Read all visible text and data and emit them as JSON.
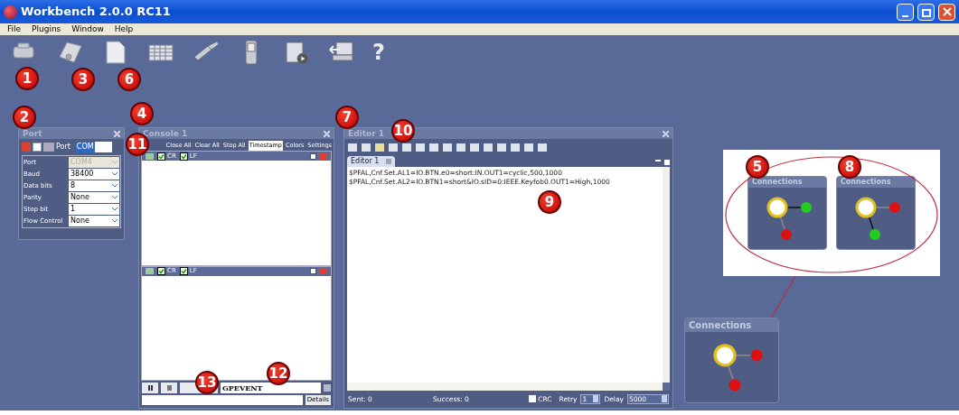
{
  "window": {
    "title": "Workbench 2.0.0 RC11"
  },
  "menu": [
    "File",
    "Plugins",
    "Window",
    "Help"
  ],
  "toolbar": {
    "help_glyph": "?"
  },
  "port": {
    "title": "Port",
    "port_label": "Port",
    "port_select": "COM",
    "fields": [
      {
        "label": "Port",
        "value": "COM4",
        "disabled": true
      },
      {
        "label": "Baud",
        "value": "38400",
        "disabled": false
      },
      {
        "label": "Data bits",
        "value": "8",
        "disabled": false
      },
      {
        "label": "Parity",
        "value": "None",
        "disabled": false
      },
      {
        "label": "Stop bit",
        "value": "1",
        "disabled": false
      },
      {
        "label": "Flow Control",
        "value": "None",
        "disabled": false
      }
    ]
  },
  "console": {
    "title": "Console 1",
    "tabs": [
      {
        "label": "Close All",
        "selected": false
      },
      {
        "label": "Clear All",
        "selected": false
      },
      {
        "label": "Stop All",
        "selected": false
      },
      {
        "label": "Timestamp",
        "selected": true
      },
      {
        "label": "Colors",
        "selected": false
      },
      {
        "label": "Settings",
        "selected": false
      }
    ],
    "panes": [
      {
        "options": [
          {
            "label": "CR",
            "checked": true
          },
          {
            "label": "LF",
            "checked": true
          }
        ]
      },
      {
        "options": [
          {
            "label": "CR",
            "checked": true
          },
          {
            "label": "LF",
            "checked": true
          }
        ]
      }
    ],
    "command": "GPEVENT",
    "details_button": "Details"
  },
  "editor": {
    "title": "Editor 1",
    "tab": "Editor 1",
    "lines": [
      "$PFAL,Cnf.Set.AL1=IO.BTN.e0=short:IN.OUT1=cyclic,500,1000",
      "$PFAL,Cnf.Set.AL2=IO.BTN1=short&IO.sID=0:IEEE.Keyfob0.OUT1=High,1000"
    ],
    "sent": "Sent: 0",
    "success": "Success: 0",
    "crc": {
      "label": "CRC",
      "checked": false
    },
    "retry_label": "Retry",
    "retry": "1",
    "delay_label": "Delay",
    "delay": "5000"
  },
  "connections": {
    "callout_panels": [
      {
        "title": "Connections",
        "nodes": [
          {
            "color": "#22cc22"
          },
          {
            "color": "#dd1111"
          }
        ]
      },
      {
        "title": "Connections",
        "nodes": [
          {
            "color": "#dd1111"
          },
          {
            "color": "#22cc22"
          }
        ]
      }
    ],
    "widget": {
      "title": "Connections",
      "nodes": [
        {
          "color": "#dd1111"
        },
        {
          "color": "#dd1111"
        }
      ]
    }
  },
  "callouts": [
    "1",
    "3",
    "6",
    "2",
    "4",
    "11",
    "7",
    "10",
    "9",
    "5",
    "8",
    "13",
    "12"
  ]
}
